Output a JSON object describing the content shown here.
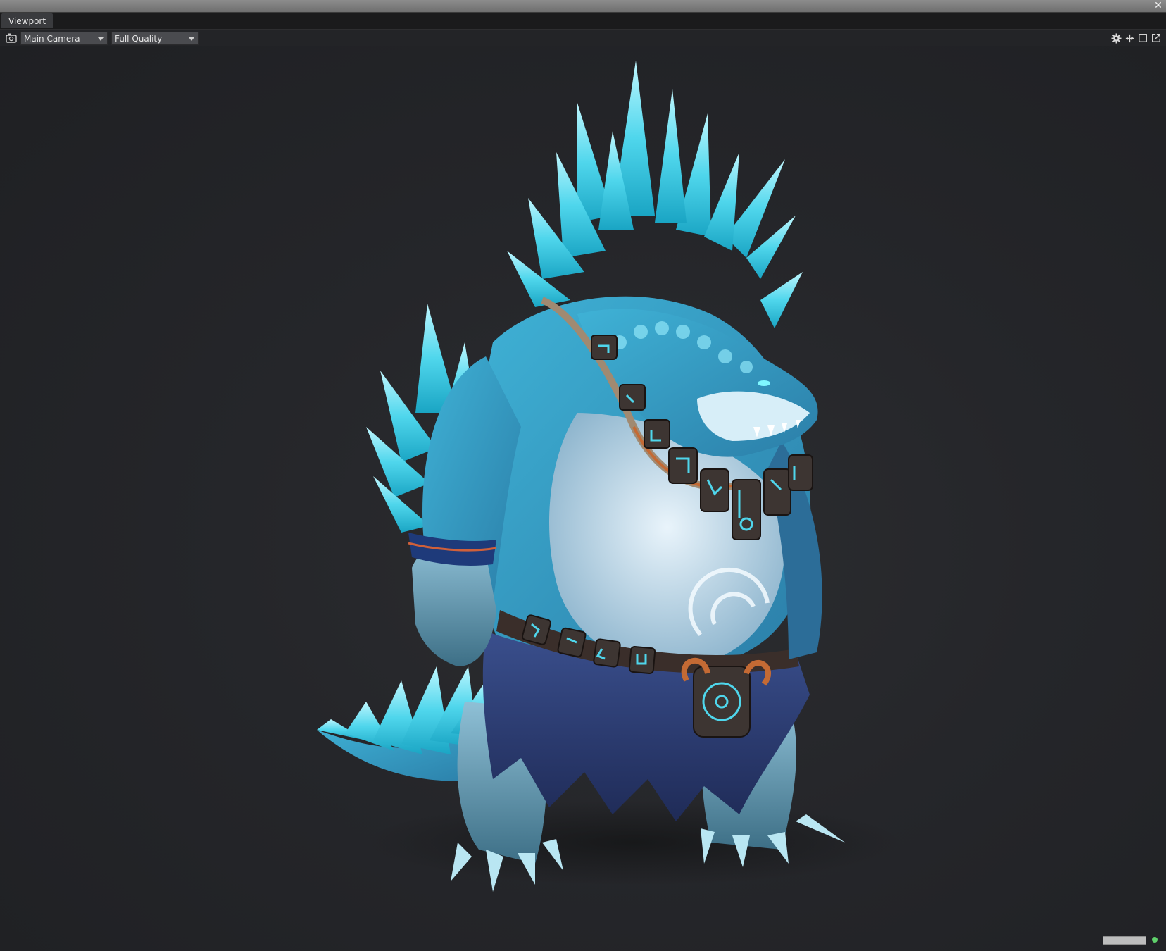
{
  "window": {
    "close_glyph": "✕"
  },
  "tabs": [
    {
      "label": "Viewport"
    }
  ],
  "toolbar": {
    "camera_icon": "camera-icon",
    "camera_dropdown": {
      "value": "Main Camera"
    },
    "quality_dropdown": {
      "value": "Full Quality"
    },
    "right_icons": [
      "gear-icon",
      "move-icon",
      "maximize-icon",
      "popout-icon"
    ]
  },
  "viewport": {
    "subject": "ice-dragon-character-model",
    "background_color": "#232427",
    "accent_color": "#4fd6ec"
  },
  "status": {
    "indicator_color": "#5fd16b"
  }
}
